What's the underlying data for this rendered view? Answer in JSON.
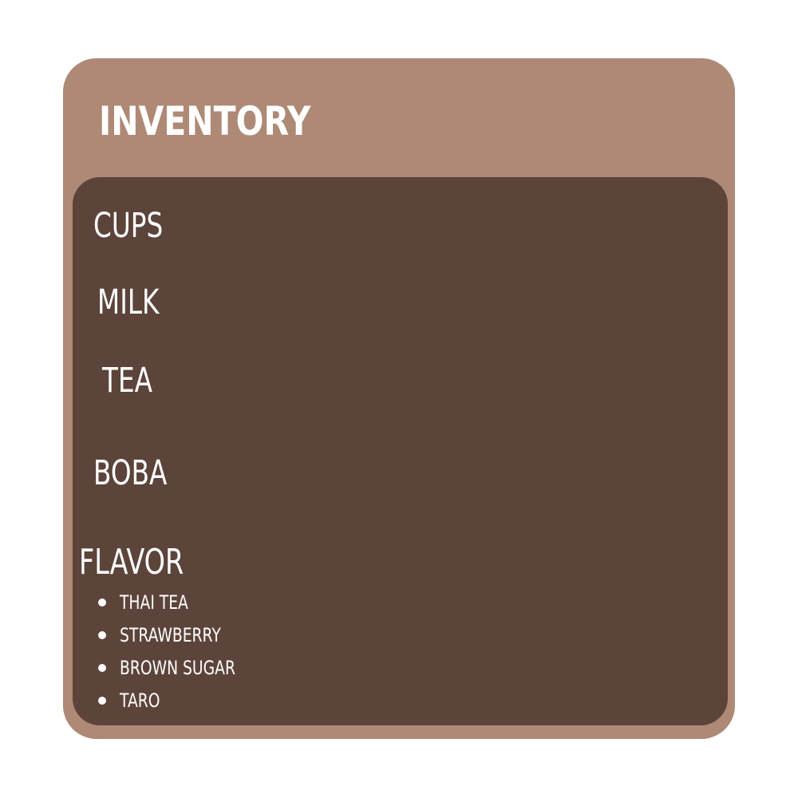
{
  "card": {
    "title": "INVENTORY"
  },
  "inventory": {
    "items": [
      {
        "label": "CUPS"
      },
      {
        "label": "MILK"
      },
      {
        "label": "TEA"
      },
      {
        "label": "BOBA"
      },
      {
        "label": "FLAVOR"
      }
    ],
    "flavors": [
      {
        "label": "THAI TEA"
      },
      {
        "label": "STRAWBERRY"
      },
      {
        "label": "BROWN SUGAR"
      },
      {
        "label": "TARO"
      }
    ]
  },
  "colors": {
    "background": "#ffffff",
    "card": "#ae8975",
    "panel": "#5c443a",
    "text": "#ffffff"
  }
}
